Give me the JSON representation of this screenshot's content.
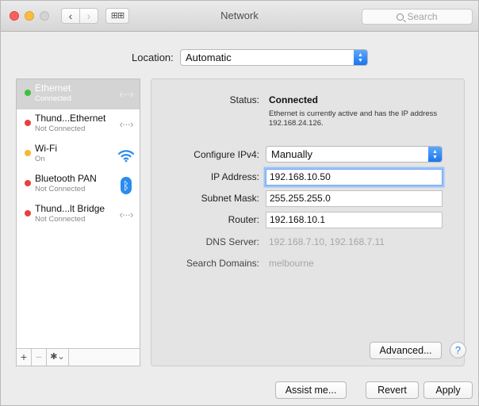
{
  "window": {
    "title": "Network",
    "search_placeholder": "Search",
    "nav": {
      "back": "‹",
      "forward": "›",
      "grid": "⊞⊞"
    }
  },
  "location": {
    "label": "Location:",
    "value": "Automatic"
  },
  "services": [
    {
      "name": "Ethernet",
      "status": "Connected",
      "dot_color": "#3cc13b",
      "icon": "ethernet-icon",
      "selected": true
    },
    {
      "name": "Thund...Ethernet",
      "status": "Not Connected",
      "dot_color": "#e8403b",
      "icon": "ethernet-icon",
      "selected": false
    },
    {
      "name": "Wi-Fi",
      "status": "On",
      "dot_color": "#f7b731",
      "icon": "wifi-icon",
      "selected": false
    },
    {
      "name": "Bluetooth PAN",
      "status": "Not Connected",
      "dot_color": "#e8403b",
      "icon": "bluetooth-icon",
      "selected": false
    },
    {
      "name": "Thund...lt Bridge",
      "status": "Not Connected",
      "dot_color": "#e8403b",
      "icon": "ethernet-icon",
      "selected": false
    }
  ],
  "sidebar_buttons": {
    "add": "+",
    "remove": "−",
    "action": "✱⌄"
  },
  "detail": {
    "status_label": "Status:",
    "status_value": "Connected",
    "status_description": "Ethernet is currently active and has the IP address 192.168.24.126.",
    "configure_label": "Configure IPv4:",
    "configure_value": "Manually",
    "ip_label": "IP Address:",
    "ip_value": "192.168.10.50",
    "subnet_label": "Subnet Mask:",
    "subnet_value": "255.255.255.0",
    "router_label": "Router:",
    "router_value": "192.168.10.1",
    "dns_label": "DNS Server:",
    "dns_value": "192.168.7.10, 192.168.7.11",
    "search_domains_label": "Search Domains:",
    "search_domains_value": "melbourne",
    "advanced_label": "Advanced...",
    "help_label": "?"
  },
  "footer": {
    "assist_label": "Assist me...",
    "revert_label": "Revert",
    "apply_label": "Apply"
  },
  "colors": {
    "accent": "#1a75f1",
    "selected_row": "#d4d4d4",
    "connected": "#3cc13b",
    "not_connected": "#e8403b",
    "on": "#f7b731"
  }
}
